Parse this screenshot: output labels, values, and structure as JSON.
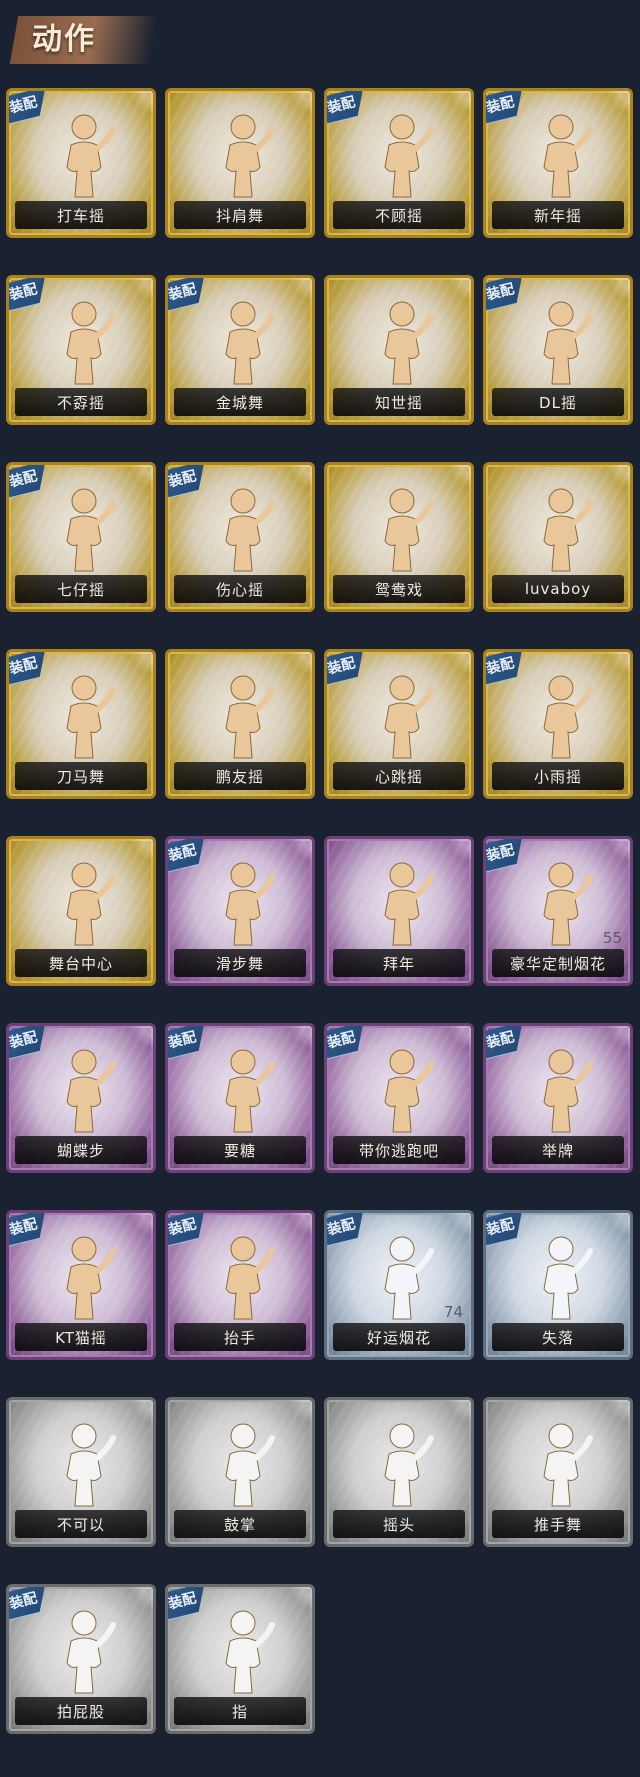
{
  "page": {
    "title": "动作"
  },
  "colors": {
    "gold": "#b99c3a",
    "purple": "#8f5f9a",
    "blue": "#8496aa",
    "gray": "#8e8e8e",
    "badge": "#2f5b8f"
  },
  "equip_badge_text": "装配",
  "actions": [
    {
      "label": "打车摇",
      "rarity": "gold",
      "equipped": true
    },
    {
      "label": "抖肩舞",
      "rarity": "gold",
      "equipped": false
    },
    {
      "label": "不顾摇",
      "rarity": "gold",
      "equipped": true
    },
    {
      "label": "新年摇",
      "rarity": "gold",
      "equipped": true
    },
    {
      "label": "不孬摇",
      "rarity": "gold",
      "equipped": true
    },
    {
      "label": "金城舞",
      "rarity": "gold",
      "equipped": true
    },
    {
      "label": "知世摇",
      "rarity": "gold",
      "equipped": false
    },
    {
      "label": "DL摇",
      "rarity": "gold",
      "equipped": true
    },
    {
      "label": "七仔摇",
      "rarity": "gold",
      "equipped": true
    },
    {
      "label": "伤心摇",
      "rarity": "gold",
      "equipped": true
    },
    {
      "label": "鸳鸯戏",
      "rarity": "gold",
      "equipped": false
    },
    {
      "label": "luvaboy",
      "rarity": "gold",
      "equipped": false
    },
    {
      "label": "刀马舞",
      "rarity": "gold",
      "equipped": true
    },
    {
      "label": "鹏友摇",
      "rarity": "gold",
      "equipped": false
    },
    {
      "label": "心跳摇",
      "rarity": "gold",
      "equipped": true
    },
    {
      "label": "小雨摇",
      "rarity": "gold",
      "equipped": true
    },
    {
      "label": "舞台中心",
      "rarity": "gold",
      "equipped": false
    },
    {
      "label": "滑步舞",
      "rarity": "purple",
      "equipped": true
    },
    {
      "label": "拜年",
      "rarity": "purple",
      "equipped": false
    },
    {
      "label": "豪华定制烟花",
      "rarity": "purple",
      "equipped": true,
      "count": "55"
    },
    {
      "label": "蝴蝶步",
      "rarity": "purple",
      "equipped": true
    },
    {
      "label": "要糖",
      "rarity": "purple",
      "equipped": true
    },
    {
      "label": "带你逃跑吧",
      "rarity": "purple",
      "equipped": true
    },
    {
      "label": "举牌",
      "rarity": "purple",
      "equipped": true
    },
    {
      "label": "KT猫摇",
      "rarity": "purple",
      "equipped": true
    },
    {
      "label": "抬手",
      "rarity": "purple",
      "equipped": true
    },
    {
      "label": "好运烟花",
      "rarity": "blue",
      "equipped": true,
      "count": "74"
    },
    {
      "label": "失落",
      "rarity": "blue",
      "equipped": true
    },
    {
      "label": "不可以",
      "rarity": "gray",
      "equipped": false
    },
    {
      "label": "鼓掌",
      "rarity": "gray",
      "equipped": false
    },
    {
      "label": "摇头",
      "rarity": "gray",
      "equipped": false
    },
    {
      "label": "推手舞",
      "rarity": "gray",
      "equipped": false
    },
    {
      "label": "拍屁股",
      "rarity": "gray",
      "equipped": true
    },
    {
      "label": "指",
      "rarity": "gray",
      "equipped": true
    }
  ]
}
